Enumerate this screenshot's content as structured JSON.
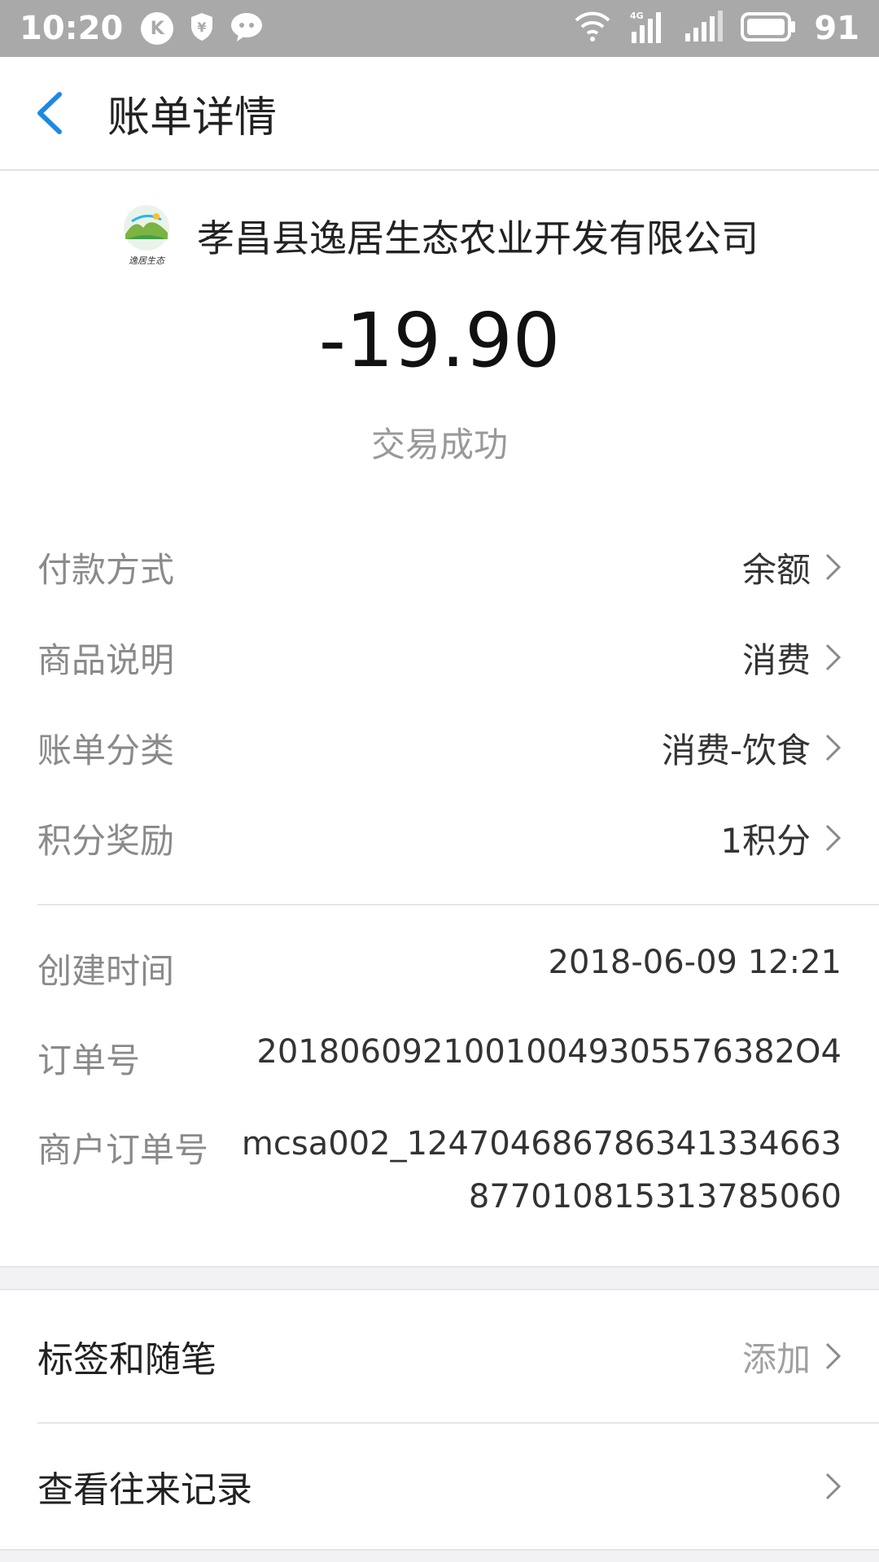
{
  "status_bar": {
    "time": "10:20",
    "left_icons": [
      "k-badge-icon",
      "shield-yen-icon",
      "chat-bubble-icon"
    ],
    "battery": "91",
    "network_label": "4G"
  },
  "header": {
    "title": "账单详情"
  },
  "merchant": {
    "name": "孝昌县逸居生态农业开发有限公司",
    "logo_text": "逸居生态"
  },
  "amount": "-19.90",
  "status": "交易成功",
  "details": [
    {
      "label": "付款方式",
      "value": "余额"
    },
    {
      "label": "商品说明",
      "value": "消费"
    },
    {
      "label": "账单分类",
      "value": "消费-饮食"
    },
    {
      "label": "积分奖励",
      "value": "1积分"
    }
  ],
  "info": {
    "created_label": "创建时间",
    "created_value": "2018-06-09 12:21",
    "order_label": "订单号",
    "order_value": "20180609210010049305576382O4",
    "merchant_order_label": "商户订单号",
    "merchant_order_value": "mcsa002_124704686786341334663877010815313785060"
  },
  "actions": {
    "tags_label": "标签和随笔",
    "tags_value": "添加",
    "history_label": "查看往来记录"
  },
  "colors": {
    "accent": "#1e88e5",
    "status_bar": "#a9a9a9",
    "muted_text": "#8a8a8a"
  }
}
